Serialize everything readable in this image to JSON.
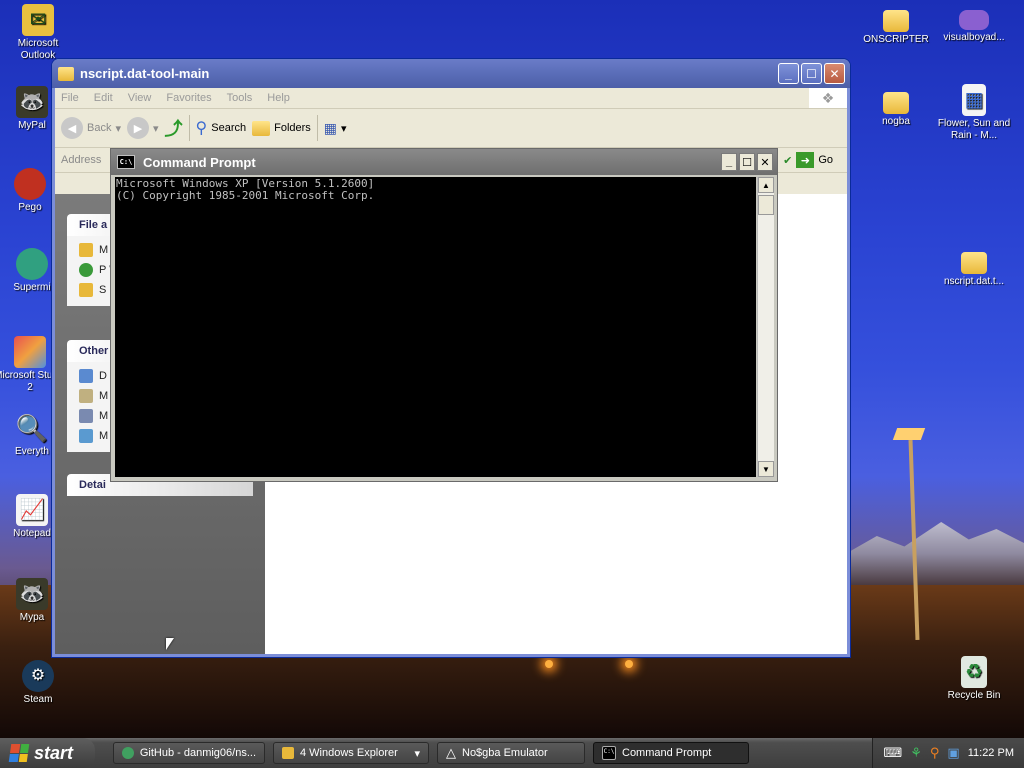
{
  "desktop": {
    "icons_left": [
      {
        "label": "Microsoft Outlook",
        "icon": "outlook-icon"
      },
      {
        "label": "MyPal",
        "icon": "mypal-icon"
      },
      {
        "label": "Pego",
        "icon": "pego-icon"
      },
      {
        "label": "Supermi",
        "icon": "supermium-icon"
      },
      {
        "label": "Microsoft Studio 2",
        "icon": "visual-studio-icon"
      },
      {
        "label": "Everyth",
        "icon": "everything-search-icon"
      },
      {
        "label": "Notepad",
        "icon": "notepad-icon"
      },
      {
        "label": "Mypa",
        "icon": "mypal-icon"
      },
      {
        "label": "Steam",
        "icon": "steam-icon"
      }
    ],
    "icons_right": [
      {
        "label": "ONSCRIPTER",
        "icon": "folder-icon"
      },
      {
        "label": "visualboyad...",
        "icon": "gameboy-advance-icon"
      },
      {
        "label": "nogba",
        "icon": "folder-icon"
      },
      {
        "label": "Flower, Sun and Rain - M...",
        "icon": "document-icon"
      },
      {
        "label": "nscript.dat.t...",
        "icon": "folder-icon"
      },
      {
        "label": "Recycle Bin",
        "icon": "recycle-bin-icon"
      }
    ]
  },
  "explorer": {
    "title": "nscript.dat-tool-main",
    "menu": [
      "File",
      "Edit",
      "View",
      "Favorites",
      "Tools",
      "Help"
    ],
    "toolbar": {
      "back": "Back",
      "search": "Search",
      "folders": "Folders"
    },
    "address_label": "Address",
    "go_label": "Go",
    "tasks": {
      "file_header": "File a",
      "file_items": [
        "M",
        "P W",
        "S"
      ],
      "other_header": "Other",
      "other_items": [
        "D",
        "M",
        "M",
        "M"
      ],
      "details_header": "Detai"
    }
  },
  "cmd": {
    "title": "Command Prompt",
    "lines": [
      "Microsoft Windows XP [Version 5.1.2600]",
      "(C) Copyright 1985-2001 Microsoft Corp."
    ]
  },
  "taskbar": {
    "start_label": "start",
    "tasks": [
      {
        "label": "GitHub - danmig06/ns...",
        "icon": "chrome-icon"
      },
      {
        "label": "4 Windows Explorer",
        "icon": "folder-icon"
      },
      {
        "label": "No$gba Emulator",
        "icon": "emulator-icon"
      },
      {
        "label": "Command Prompt",
        "icon": "cmd-icon"
      }
    ],
    "clock": "11:22 PM"
  },
  "colors": {
    "sky": "#2a43d2",
    "inactive_title": "#5a6db8",
    "cmd_title": "#7a7a7a",
    "taskbar": "#3e3e3e"
  }
}
